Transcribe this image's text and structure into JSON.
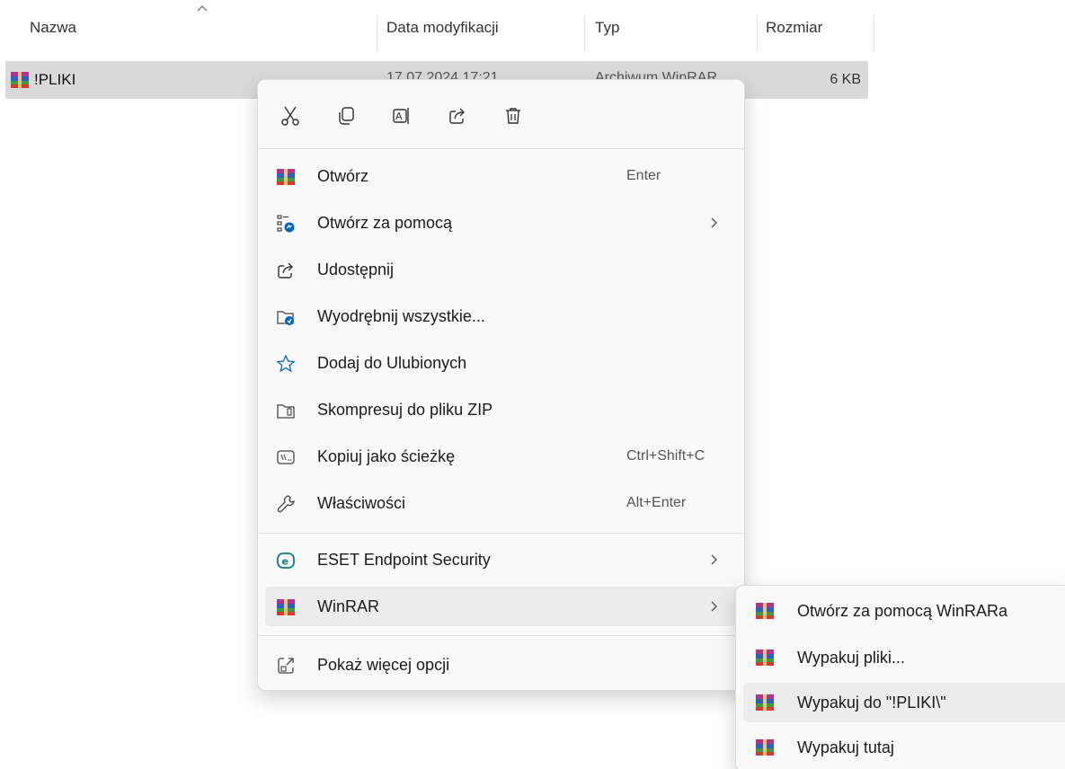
{
  "columns": {
    "name": "Nazwa",
    "date": "Data modyfikacji",
    "type": "Typ",
    "size": "Rozmiar"
  },
  "file": {
    "name": "!PLIKI",
    "date": "17.07.2024 17:21",
    "type": "Archiwum WinRAR",
    "size": "6 KB",
    "icon": "winrar-icon"
  },
  "quick_actions": [
    {
      "icon": "cut-icon"
    },
    {
      "icon": "copy-icon"
    },
    {
      "icon": "rename-icon"
    },
    {
      "icon": "share-icon"
    },
    {
      "icon": "delete-icon"
    }
  ],
  "menu": {
    "open": {
      "label": "Otwórz",
      "shortcut": "Enter",
      "icon": "winrar-icon"
    },
    "open_with": {
      "label": "Otwórz za pomocą",
      "icon": "open-with-icon"
    },
    "share": {
      "label": "Udostępnij",
      "icon": "share-icon"
    },
    "extract_all": {
      "label": "Wyodrębnij wszystkie...",
      "icon": "extract-folder-icon"
    },
    "favorites": {
      "label": "Dodaj do Ulubionych",
      "icon": "star-icon"
    },
    "compress_zip": {
      "label": "Skompresuj do pliku ZIP",
      "icon": "zip-folder-icon"
    },
    "copy_path": {
      "label": "Kopiuj jako ścieżkę",
      "shortcut": "Ctrl+Shift+C",
      "icon": "path-icon"
    },
    "properties": {
      "label": "Właściwości",
      "shortcut": "Alt+Enter",
      "icon": "wrench-icon"
    },
    "eset": {
      "label": "ESET Endpoint Security",
      "icon": "eset-icon"
    },
    "winrar": {
      "label": "WinRAR",
      "icon": "winrar-icon"
    },
    "more": {
      "label": "Pokaż więcej opcji",
      "icon": "more-options-icon"
    }
  },
  "submenu": [
    {
      "label": "Otwórz za pomocą WinRARa",
      "icon": "winrar-icon"
    },
    {
      "label": "Wypakuj pliki...",
      "icon": "winrar-icon"
    },
    {
      "label": "Wypakuj do \"!PLIKI\\\"",
      "icon": "winrar-icon"
    },
    {
      "label": "Wypakuj tutaj",
      "icon": "winrar-icon"
    }
  ],
  "colors": {
    "selection": "#d9d9d9",
    "menu_bg": "#f9f9f9",
    "hover": "#ececec",
    "accent": "#0067c0"
  }
}
